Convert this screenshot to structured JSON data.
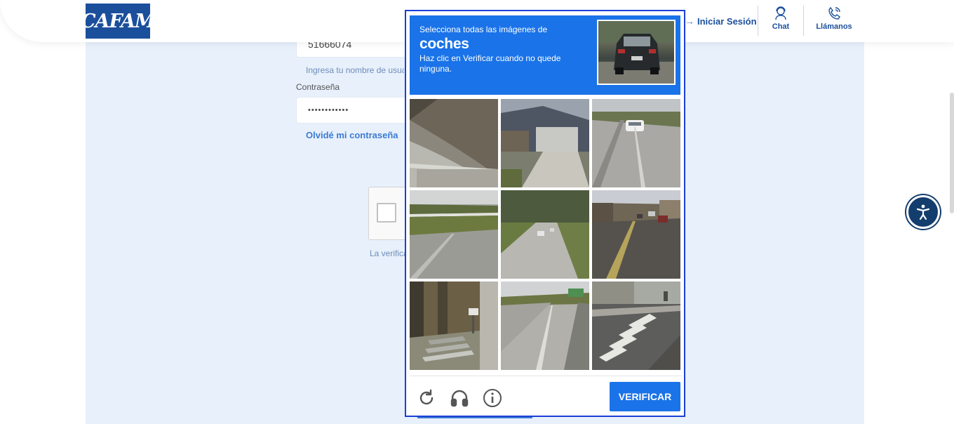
{
  "header": {
    "logo_text": "CAFAM",
    "login_label": "Iniciar Sesión",
    "chat_label": "Chat",
    "call_label": "Llámanos"
  },
  "form": {
    "username_value": "51666074",
    "username_hint": "Ingresa tu nombre de usuario",
    "password_label": "Contraseña",
    "password_value": "••••••••••••",
    "forgot_link": "Olvidé mi contraseña",
    "verification_note": "La verificación"
  },
  "captcha": {
    "instruction_line1": "Selecciona todas las imágenes de",
    "target_word": "coches",
    "instruction_line3": "Haz clic en Verificar cuando no quede ninguna.",
    "verify_button": "VERIFICAR",
    "tiles": [
      {
        "name": "tile-overpass"
      },
      {
        "name": "tile-garage-house"
      },
      {
        "name": "tile-road-white-car"
      },
      {
        "name": "tile-road-guardrail"
      },
      {
        "name": "tile-curved-road"
      },
      {
        "name": "tile-street-cars"
      },
      {
        "name": "tile-stairs-forest"
      },
      {
        "name": "tile-highway-road"
      },
      {
        "name": "tile-crosswalk"
      }
    ]
  },
  "colors": {
    "brand_blue": "#1b4f9c",
    "captcha_blue": "#1a73e8",
    "page_band": "#e7f0fb",
    "modal_border": "#1b3fd6"
  },
  "icons": [
    "login-arrow-icon",
    "chat-agent-icon",
    "phone-icon",
    "accessibility-icon",
    "reload-icon",
    "audio-icon",
    "info-icon"
  ]
}
